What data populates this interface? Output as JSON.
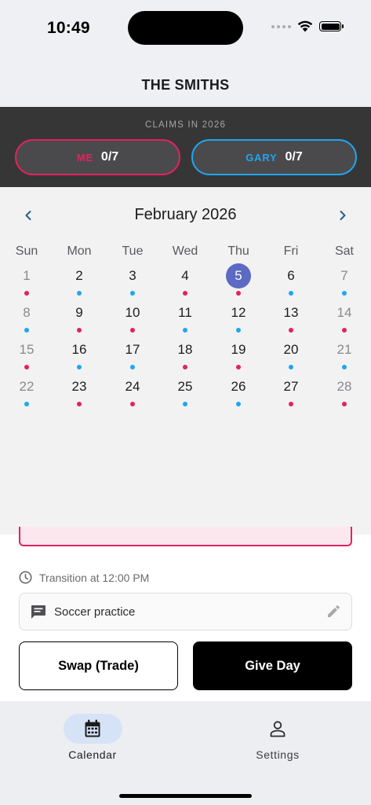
{
  "status_bar": {
    "time": "10:49"
  },
  "header": {
    "title": "THE SMITHS"
  },
  "claims": {
    "title": "CLAIMS IN 2026",
    "me": {
      "name": "ME",
      "count": "0/7",
      "color": "#e4225c"
    },
    "gary": {
      "name": "GARY",
      "count": "0/7",
      "color": "#1ea6f1"
    }
  },
  "calendar": {
    "month_title": "February 2026",
    "weekdays": [
      "Sun",
      "Mon",
      "Tue",
      "Wed",
      "Thu",
      "Fri",
      "Sat"
    ],
    "selected_day": "5",
    "weeks": [
      [
        {
          "d": "1",
          "owner": "me"
        },
        {
          "d": "2",
          "owner": "gary"
        },
        {
          "d": "3",
          "owner": "gary"
        },
        {
          "d": "4",
          "owner": "me"
        },
        {
          "d": "5",
          "owner": "me"
        },
        {
          "d": "6",
          "owner": "gary"
        },
        {
          "d": "7",
          "owner": "gary"
        }
      ],
      [
        {
          "d": "8",
          "owner": "gary"
        },
        {
          "d": "9",
          "owner": "me"
        },
        {
          "d": "10",
          "owner": "me"
        },
        {
          "d": "11",
          "owner": "gary"
        },
        {
          "d": "12",
          "owner": "gary"
        },
        {
          "d": "13",
          "owner": "me"
        },
        {
          "d": "14",
          "owner": "me"
        }
      ],
      [
        {
          "d": "15",
          "owner": "me"
        },
        {
          "d": "16",
          "owner": "gary"
        },
        {
          "d": "17",
          "owner": "gary"
        },
        {
          "d": "18",
          "owner": "me"
        },
        {
          "d": "19",
          "owner": "me"
        },
        {
          "d": "20",
          "owner": "gary"
        },
        {
          "d": "21",
          "owner": "gary"
        }
      ],
      [
        {
          "d": "22",
          "owner": "gary"
        },
        {
          "d": "23",
          "owner": "me"
        },
        {
          "d": "24",
          "owner": "me"
        },
        {
          "d": "25",
          "owner": "gary"
        },
        {
          "d": "26",
          "owner": "gary"
        },
        {
          "d": "27",
          "owner": "me"
        },
        {
          "d": "28",
          "owner": "me"
        }
      ]
    ]
  },
  "detail": {
    "transition": "Transition at 12:00 PM",
    "note": "Soccer practice",
    "swap_button": "Swap (Trade)",
    "give_button": "Give Day"
  },
  "tabbar": {
    "calendar_label": "Calendar",
    "settings_label": "Settings"
  },
  "icons": {
    "prev": "chevron-left-icon",
    "next": "chevron-right-icon",
    "clock": "clock-icon",
    "note": "comment-icon",
    "edit": "pencil-icon",
    "calendar": "calendar-icon",
    "settings": "person-icon"
  },
  "colors": {
    "selected_day": "#5c6ac4",
    "tab_active_bg": "#d6e3f7"
  }
}
